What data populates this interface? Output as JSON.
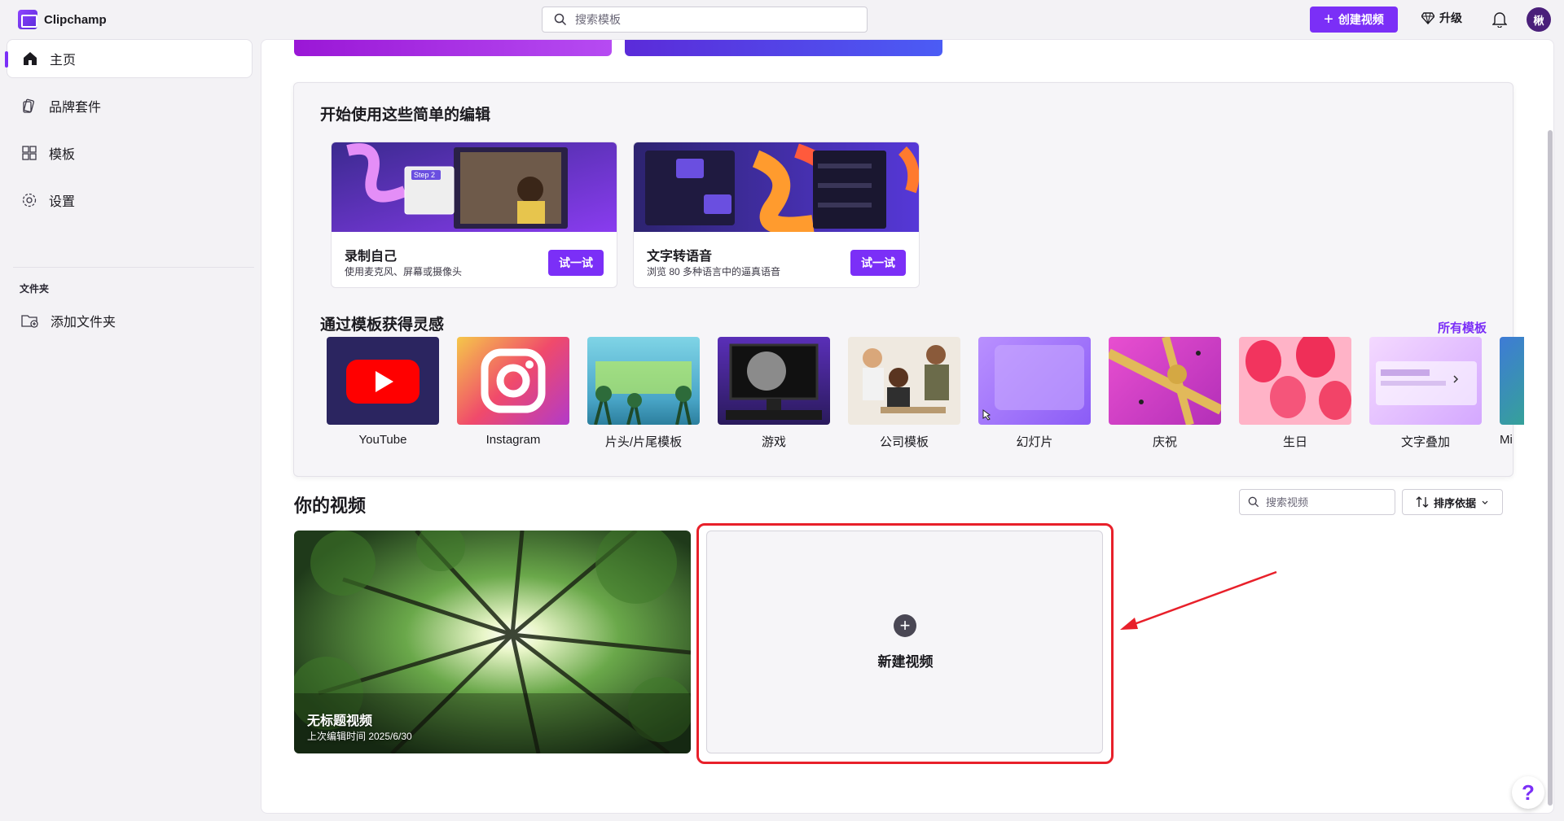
{
  "app": {
    "name": "Clipchamp"
  },
  "header": {
    "search_placeholder": "搜索模板",
    "create_label": "创建视频",
    "upgrade_label": "升级",
    "avatar_initial": "楸"
  },
  "sidebar": {
    "items": [
      {
        "label": "主页",
        "icon": "home-icon",
        "active": true
      },
      {
        "label": "品牌套件",
        "icon": "brand-kit-icon"
      },
      {
        "label": "模板",
        "icon": "templates-icon"
      },
      {
        "label": "设置",
        "icon": "gear-icon"
      }
    ],
    "folders_heading": "文件夹",
    "add_folder_label": "添加文件夹"
  },
  "easy_edits": {
    "title": "开始使用这些简单的编辑",
    "cards": [
      {
        "title": "录制自己",
        "subtitle": "使用麦克风、屏幕或摄像头",
        "button": "试一试",
        "image_label": "Step 2"
      },
      {
        "title": "文字转语音",
        "subtitle": "浏览 80 多种语言中的逼真语音",
        "button": "试一试"
      }
    ]
  },
  "templates": {
    "title": "通过模板获得灵感",
    "all_link": "所有模板",
    "items": [
      {
        "label": "YouTube"
      },
      {
        "label": "Instagram"
      },
      {
        "label": "片头/片尾模板"
      },
      {
        "label": "游戏"
      },
      {
        "label": "公司模板"
      },
      {
        "label": "幻灯片"
      },
      {
        "label": "庆祝"
      },
      {
        "label": "生日"
      },
      {
        "label": "文字叠加"
      },
      {
        "label": "Mi"
      }
    ]
  },
  "videos": {
    "title": "你的视频",
    "search_placeholder": "搜索视频",
    "sort_label": "排序依据",
    "items": [
      {
        "title": "无标题视频",
        "subtitle": "上次编辑时间 2025/6/30"
      }
    ],
    "new_video_label": "新建视频"
  },
  "colors": {
    "accent": "#7b2ff7",
    "highlight": "#e8202a"
  }
}
